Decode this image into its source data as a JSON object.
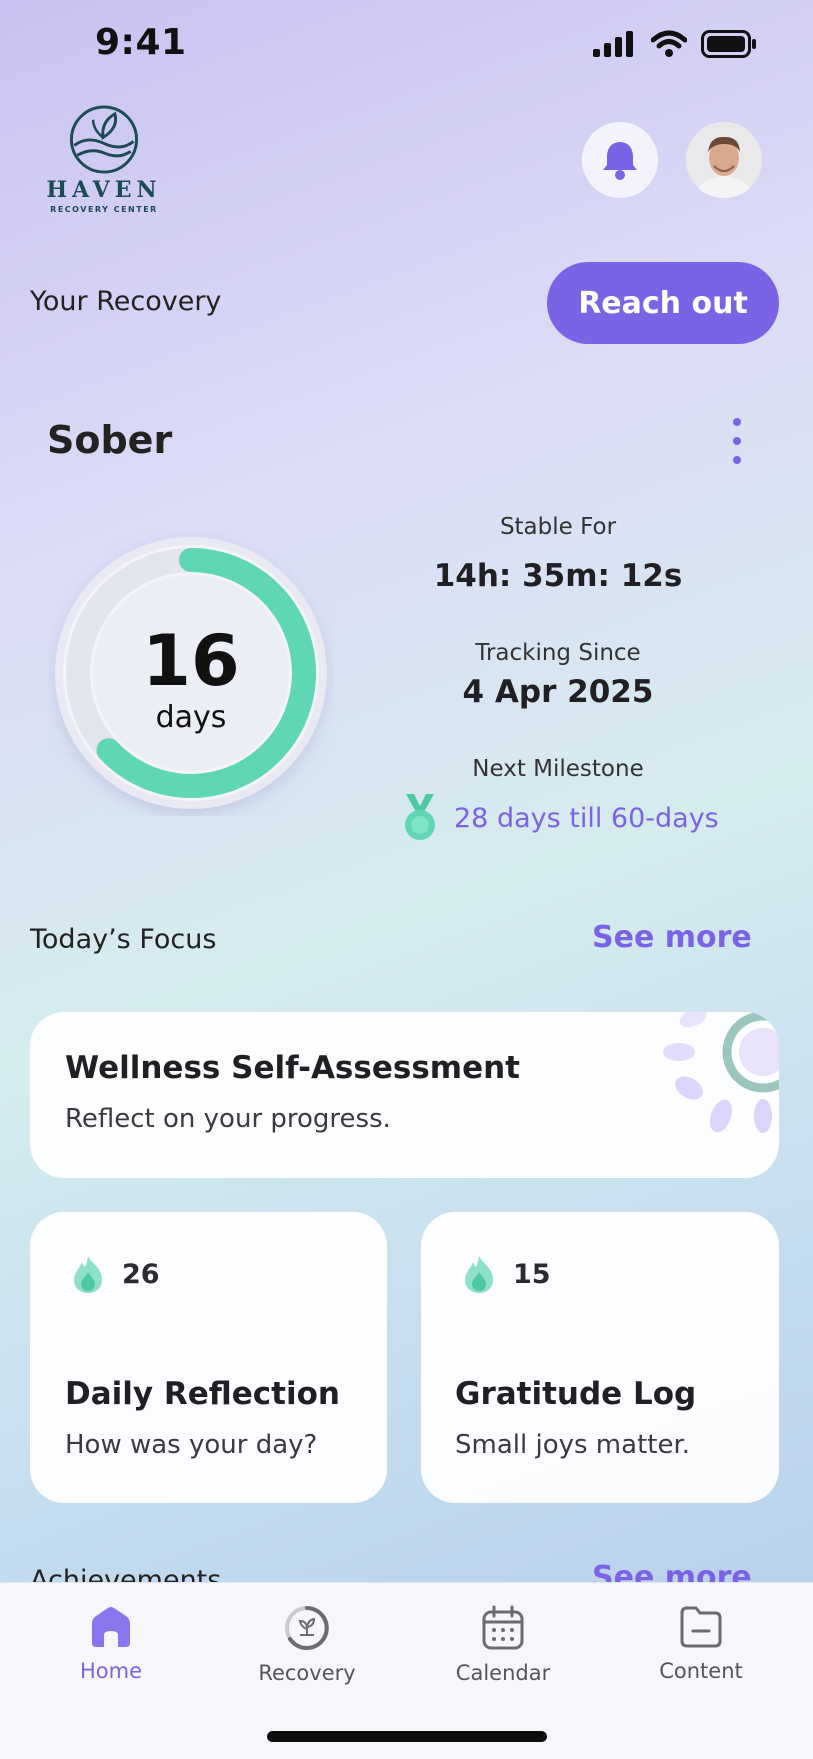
{
  "status_bar": {
    "time": "9:41"
  },
  "header": {
    "logo_name": "HAVEN",
    "logo_sub": "RECOVERY CENTER"
  },
  "recovery": {
    "section_title": "Your Recovery",
    "reach_out_label": "Reach out",
    "tracker_name": "Sober",
    "days_count": "16",
    "days_unit": "days",
    "ring_progress": 0.63,
    "stable_for_label": "Stable For",
    "stable_for_value": "14h: 35m: 12s",
    "tracking_since_label": "Tracking Since",
    "tracking_since_value": "4 Apr 2025",
    "next_milestone_label": "Next Milestone",
    "next_milestone_value": "28 days till 60-days"
  },
  "focus": {
    "section_title": "Today’s Focus",
    "see_more_label": "See more",
    "featured": {
      "title": "Wellness Self-Assessment",
      "subtitle": "Reflect on your progress."
    },
    "cards": [
      {
        "streak": "26",
        "title": "Daily Reflection",
        "subtitle": "How was your day?"
      },
      {
        "streak": "15",
        "title": "Gratitude Log",
        "subtitle": "Small joys matter."
      }
    ]
  },
  "achievements": {
    "section_title": "Achievements",
    "see_more_label": "See more"
  },
  "nav": {
    "items": [
      {
        "label": "Home",
        "icon": "home-icon",
        "active": true
      },
      {
        "label": "Recovery",
        "icon": "recovery-icon",
        "active": false
      },
      {
        "label": "Calendar",
        "icon": "calendar-icon",
        "active": false
      },
      {
        "label": "Content",
        "icon": "content-icon",
        "active": false
      }
    ]
  },
  "colors": {
    "accent": "#7b63e6",
    "ring": "#5fd6b4",
    "logo": "#1d4b55"
  }
}
